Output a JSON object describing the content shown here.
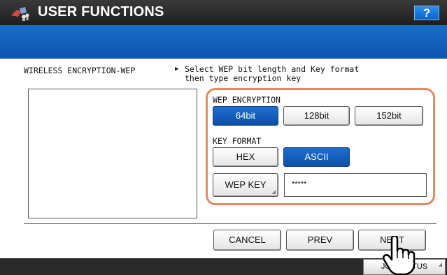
{
  "header": {
    "title": "USER FUNCTIONS",
    "help_label": "?"
  },
  "section": {
    "label": "WIRELESS ENCRYPTION-WEP",
    "instruction": "Select WEP bit length and Key format\nthen type encryption key"
  },
  "wep_encryption": {
    "label": "WEP ENCRYPTION",
    "options": [
      "64bit",
      "128bit",
      "152bit"
    ],
    "selected": "64bit"
  },
  "key_format": {
    "label": "KEY FORMAT",
    "options": [
      "HEX",
      "ASCII"
    ],
    "selected": "ASCII"
  },
  "wep_key": {
    "button_label": "WEP KEY",
    "value": "*****"
  },
  "footer": {
    "cancel_label": "CANCEL",
    "prev_label": "PREV",
    "next_label": "NEXT",
    "job_status_label": "JOB STATUS"
  },
  "colors": {
    "selected_blue": "#0c4fa8",
    "frame_accent": "#e08a66",
    "band_blue": "#1a6cc9"
  }
}
